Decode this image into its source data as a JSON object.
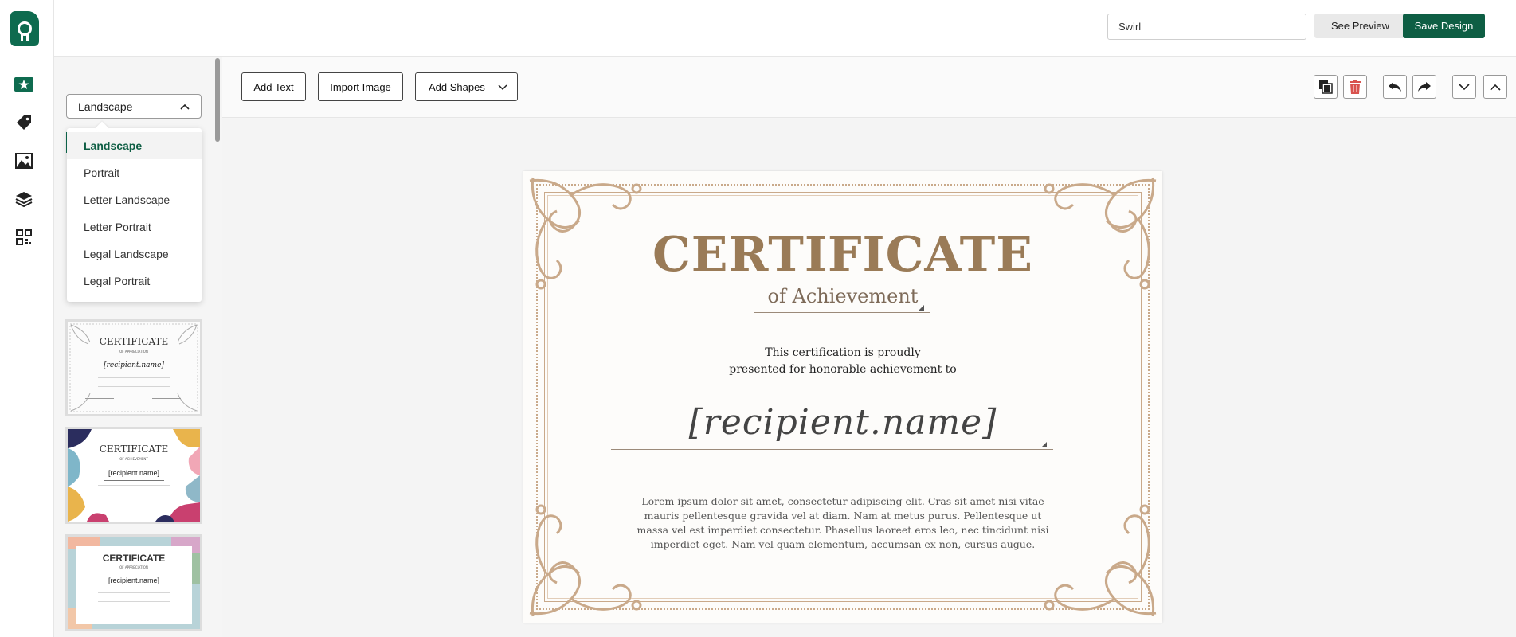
{
  "topbar": {
    "design_name": "Swirl",
    "preview_label": "See Preview",
    "save_label": "Save Design"
  },
  "rail": {
    "icons": [
      "award-icon",
      "tag-icon",
      "image-icon",
      "layers-icon",
      "qr-code-icon"
    ]
  },
  "panel": {
    "orientation_selected": "Landscape",
    "orientation_options": [
      "Landscape",
      "Portrait",
      "Letter Landscape",
      "Letter Portrait",
      "Legal Landscape",
      "Legal Portrait"
    ],
    "thumbnails": [
      {
        "title": "CERTIFICATE",
        "subtitle": "OF APPRECIATION",
        "name": "[recipient.name]"
      },
      {
        "title": "CERTIFICATE",
        "subtitle": "OF ACHIEVEMENT",
        "name": "[recipient.name]"
      },
      {
        "title": "CERTIFICATE",
        "subtitle": "OF APPRECIATION",
        "name": "[recipient.name]"
      }
    ]
  },
  "toolbar": {
    "add_text": "Add Text",
    "import_image": "Import Image",
    "add_shapes": "Add Shapes"
  },
  "certificate": {
    "title": "CERTIFICATE",
    "subtitle": "of Achievement",
    "intro_line1": "This certification is proudly",
    "intro_line2": "presented for honorable achievement to",
    "recipient": "[recipient.name]",
    "body": "Lorem ipsum dolor sit amet, consectetur adipiscing elit. Cras sit amet nisi vitae mauris pellentesque gravida vel at diam. Nam at metus purus. Pellentesque ut massa vel est imperdiet consectetur. Phasellus laoreet eros leo, nec tincidunt nisi imperdiet eget. Nam vel quam elementum, accumsan ex non, cursus augue."
  },
  "colors": {
    "brand": "#0e5e44",
    "gold": "#9a7b57",
    "danger": "#d9534f"
  }
}
